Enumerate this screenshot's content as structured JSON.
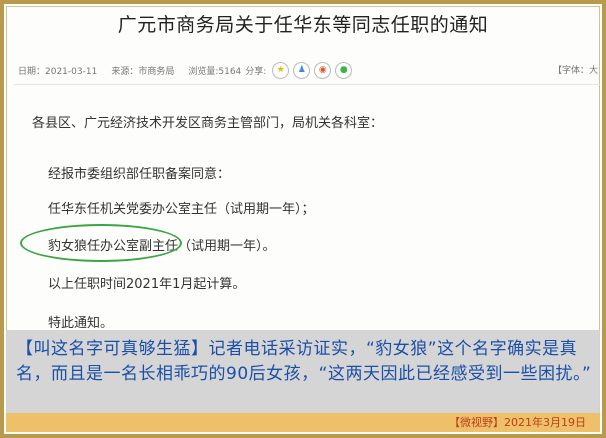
{
  "article": {
    "title": "广元市商务局关于任华东等同志任职的通知",
    "meta": {
      "date": "日期：2021-03-11",
      "source": "来源：市商务局",
      "views": "浏览量:5164",
      "share_label": "分享:"
    },
    "font_size_label": "【字体：大",
    "share_icons": [
      {
        "name": "qzone",
        "glyph": "★",
        "color": "#f5b400"
      },
      {
        "name": "qq",
        "glyph": "♟",
        "color": "#3b8fd8"
      },
      {
        "name": "weibo",
        "glyph": "◉",
        "color": "#e2542a"
      },
      {
        "name": "wechat",
        "glyph": "●",
        "color": "#3db34a"
      }
    ],
    "salutation": "各县区、广元经济技术开发区商务主管部门，局机关各科室：",
    "paragraphs": [
      "经报市委组织部任职备案同意：",
      "任华东任机关党委办公室主任（试用期一年）；",
      "豹女狼任办公室副主任（试用期一年）。",
      "以上任职时间2021年1月起计算。",
      "特此通知。"
    ]
  },
  "caption": "【叫这名字可真够生猛】记者电话采访证实，“豹女狼”这个名字确实是真名，而且是一名长相乖巧的90后女孩，“这两天因此已经感受到一些困扰。”",
  "credit": "【微视野】2021年3月19日",
  "colors": {
    "frame": "#b99a4d",
    "caption_text": "#1a4fa8",
    "credit_bg": "#efc06a",
    "credit_text": "#b8401a",
    "highlight_circle": "#3aa543"
  }
}
